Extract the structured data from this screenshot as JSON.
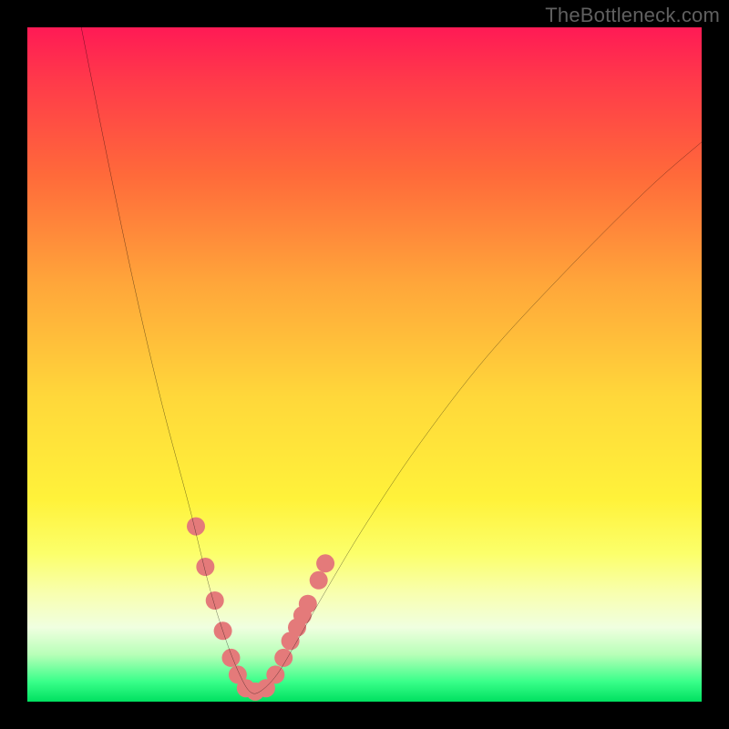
{
  "watermark": "TheBottleneck.com",
  "chart_data": {
    "type": "line",
    "title": "",
    "xlabel": "",
    "ylabel": "",
    "xlim": [
      0,
      100
    ],
    "ylim": [
      0,
      100
    ],
    "grid": false,
    "legend": false,
    "series": [
      {
        "name": "curve",
        "x": [
          8,
          12,
          16,
          20,
          24,
          27,
          29.5,
          31.5,
          33,
          34.5,
          37,
          40,
          44,
          50,
          58,
          68,
          80,
          92,
          100
        ],
        "y": [
          100,
          80,
          61,
          44,
          29,
          17,
          9,
          4,
          1.5,
          1.5,
          4,
          9,
          16,
          26,
          38,
          51,
          64,
          76,
          83
        ],
        "color": "#000000",
        "stroke_width": 2
      },
      {
        "name": "dots",
        "x": [
          25.0,
          26.4,
          27.8,
          29.0,
          30.2,
          31.2,
          32.4,
          33.8,
          35.4,
          36.8,
          38.0,
          39.0,
          40.0,
          40.8,
          41.6,
          43.2,
          44.2
        ],
        "y": [
          26.0,
          20.0,
          15.0,
          10.5,
          6.5,
          4.0,
          2.0,
          1.5,
          2.0,
          4.0,
          6.5,
          9.0,
          11.0,
          12.8,
          14.5,
          18.0,
          20.5
        ],
        "color": "#e47a7a",
        "marker_radius": 10
      }
    ],
    "background_gradient": {
      "direction": "vertical",
      "stops": [
        {
          "pos": 0.0,
          "color": "#ff1a55"
        },
        {
          "pos": 0.55,
          "color": "#ffd83a"
        },
        {
          "pos": 0.9,
          "color": "#f0ffe0"
        },
        {
          "pos": 1.0,
          "color": "#00e060"
        }
      ]
    }
  }
}
